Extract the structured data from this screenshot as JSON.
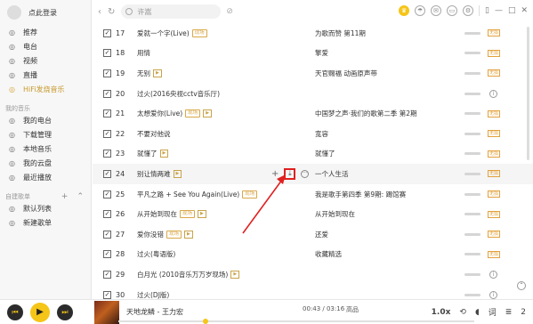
{
  "sidebar": {
    "login": "点此登录",
    "nav": [
      {
        "label": "推荐",
        "icon": "recommend-icon"
      },
      {
        "label": "电台",
        "icon": "radio-icon"
      },
      {
        "label": "视频",
        "icon": "video-icon"
      },
      {
        "label": "直播",
        "icon": "live-icon"
      },
      {
        "label": "HiFi发烧音乐",
        "icon": "hifi-icon"
      }
    ],
    "my_music_title": "我的音乐",
    "my_music": [
      {
        "label": "我的电台",
        "icon": "my-radio-icon"
      },
      {
        "label": "下载管理",
        "icon": "download-icon"
      },
      {
        "label": "本地音乐",
        "icon": "local-music-icon"
      },
      {
        "label": "我的云盘",
        "icon": "cloud-icon"
      },
      {
        "label": "最近播放",
        "icon": "recent-icon"
      }
    ],
    "playlists_title": "自建歌单",
    "playlists": [
      {
        "label": "默认列表",
        "icon": "list-icon"
      },
      {
        "label": "新建歌单",
        "icon": "new-list-icon"
      }
    ]
  },
  "topbar": {
    "search_placeholder": "许嵩"
  },
  "songs": [
    {
      "num": "17",
      "title": "爱就一个字(Live)",
      "album": "为歌而赞 第11期"
    },
    {
      "num": "18",
      "title": "用情",
      "album": "擎爱"
    },
    {
      "num": "19",
      "title": "无别",
      "album": "天官赐福 动画原声带"
    },
    {
      "num": "20",
      "title": "过火(2016央视cctv音乐厅)",
      "album": ""
    },
    {
      "num": "21",
      "title": "太想爱你(Live)",
      "album": "中国梦之声·我们的歌第二季 第2期"
    },
    {
      "num": "22",
      "title": "不要对他说",
      "album": "宽容"
    },
    {
      "num": "23",
      "title": "就懂了",
      "album": "就懂了"
    },
    {
      "num": "24",
      "title": "别让情两难",
      "album": "一个人生活"
    },
    {
      "num": "25",
      "title": "平凡之路 + See You Again(Live)",
      "album": "我是歌手第四季 第9期: 踢馆赛"
    },
    {
      "num": "26",
      "title": "从开始到现在",
      "album": "从开始到现在"
    },
    {
      "num": "27",
      "title": "爱你没错",
      "album": "还爱"
    },
    {
      "num": "28",
      "title": "过火(粤语版)",
      "album": "收藏精选"
    },
    {
      "num": "29",
      "title": "白月光 (2010音乐万万岁现场)",
      "album": ""
    },
    {
      "num": "30",
      "title": "过火(DJ版)",
      "album": ""
    }
  ],
  "badges": {
    "live": "现场",
    "mv": "▶",
    "quality": "无损"
  },
  "player": {
    "song": "天地龙鳞 - 王力宏",
    "time": "00:43 / 03:16",
    "quality": "高品",
    "speed": "1.0x",
    "count": "2"
  },
  "colors": {
    "accent": "#f5c518",
    "annotation": "#e02020"
  }
}
